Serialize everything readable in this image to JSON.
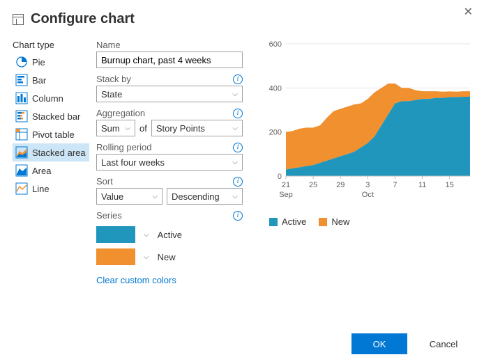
{
  "dialog_title": "Configure chart",
  "sidebar": {
    "title": "Chart type",
    "items": [
      {
        "label": "Pie"
      },
      {
        "label": "Bar"
      },
      {
        "label": "Column"
      },
      {
        "label": "Stacked bar"
      },
      {
        "label": "Pivot table"
      },
      {
        "label": "Stacked area"
      },
      {
        "label": "Area"
      },
      {
        "label": "Line"
      }
    ],
    "selected": "Stacked area"
  },
  "form": {
    "name_label": "Name",
    "name_value": "Burnup chart, past 4 weeks",
    "stackby_label": "Stack by",
    "stackby_value": "State",
    "aggregation_label": "Aggregation",
    "aggregation_func": "Sum",
    "aggregation_of": "of",
    "aggregation_field": "Story Points",
    "rolling_label": "Rolling period",
    "rolling_value": "Last four weeks",
    "sort_label": "Sort",
    "sort_field": "Value",
    "sort_dir": "Descending",
    "series_label": "Series",
    "series": [
      {
        "name": "Active",
        "color": "#2196bd"
      },
      {
        "name": "New",
        "color": "#f0902f"
      }
    ],
    "clear_link": "Clear custom colors"
  },
  "chart_data": {
    "type": "area",
    "title": "",
    "xlabel": "",
    "ylabel": "",
    "ylim": [
      0,
      600
    ],
    "y_ticks": [
      0,
      200,
      400,
      600
    ],
    "x_ticks_top": [
      "21",
      "25",
      "29",
      "3",
      "7",
      "11",
      "15"
    ],
    "x_ticks_bottom": [
      "Sep",
      "Oct"
    ],
    "categories": [
      "21",
      "22",
      "23",
      "24",
      "25",
      "26",
      "27",
      "28",
      "29",
      "30",
      "1",
      "2",
      "3",
      "4",
      "5",
      "6",
      "7",
      "8",
      "9",
      "10",
      "11",
      "12",
      "13",
      "14",
      "15",
      "16",
      "17",
      "18"
    ],
    "series": [
      {
        "name": "Active",
        "color": "#2196bd",
        "values": [
          30,
          35,
          40,
          45,
          50,
          60,
          70,
          80,
          90,
          100,
          110,
          130,
          150,
          180,
          230,
          280,
          330,
          340,
          340,
          345,
          350,
          350,
          355,
          355,
          358,
          358,
          360,
          360
        ]
      },
      {
        "name": "New",
        "color": "#f0902f",
        "values": [
          170,
          170,
          175,
          175,
          170,
          170,
          195,
          215,
          215,
          215,
          215,
          200,
          200,
          200,
          170,
          140,
          90,
          60,
          60,
          45,
          35,
          35,
          30,
          28,
          26,
          25,
          25,
          25
        ]
      }
    ],
    "legend": [
      "Active",
      "New"
    ]
  },
  "buttons": {
    "ok": "OK",
    "cancel": "Cancel"
  }
}
